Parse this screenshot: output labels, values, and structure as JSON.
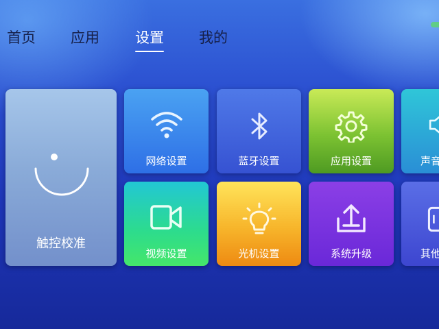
{
  "nav": {
    "tabs": [
      {
        "label": "首页",
        "active": false
      },
      {
        "label": "应用",
        "active": false
      },
      {
        "label": "设置",
        "active": true
      },
      {
        "label": "我的",
        "active": false
      }
    ]
  },
  "tiles": {
    "touch_calibration": {
      "label": "触控校准",
      "icon": "smile-face-icon"
    },
    "network": {
      "label": "网络设置",
      "icon": "wifi-icon"
    },
    "bluetooth": {
      "label": "蓝牙设置",
      "icon": "bluetooth-icon"
    },
    "app_settings": {
      "label": "应用设置",
      "icon": "gear-icon"
    },
    "sound": {
      "label": "声音",
      "icon": "speaker-icon"
    },
    "video": {
      "label": "视频设置",
      "icon": "video-camera-icon"
    },
    "projector": {
      "label": "光机设置",
      "icon": "lightbulb-icon"
    },
    "upgrade": {
      "label": "系统升级",
      "icon": "upload-icon"
    },
    "other": {
      "label": "其他",
      "icon": "device-icon"
    }
  },
  "colors": {
    "active_tab": "#ffffff",
    "inactive_tab": "#16204a",
    "background_top": "#3a6fe0",
    "background_bottom": "#16299a"
  }
}
